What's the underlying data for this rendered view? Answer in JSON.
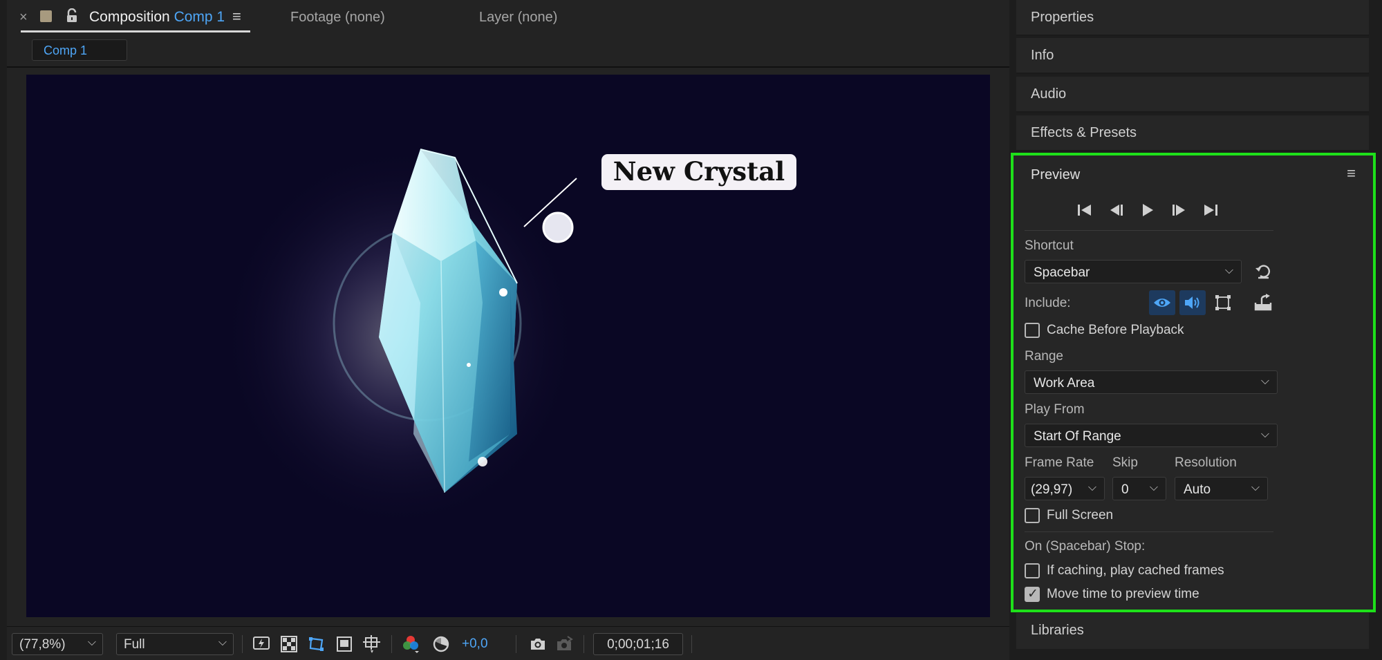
{
  "composition_panel": {
    "close_glyph": "×",
    "tab_title_prefix": "Composition",
    "tab_title_comp": "Comp 1",
    "menu_glyph": "≡",
    "footage_tab": "Footage (none)",
    "layer_tab": "Layer (none)",
    "comp_subtab": "Comp 1",
    "label_color": "#a79a7f",
    "accent_color": "#4ea6f7"
  },
  "viewer": {
    "background_color": "#0a0724",
    "callout_text": "New Crystal"
  },
  "viewer_toolbar": {
    "zoom": "(77,8%)",
    "resolution": "Full",
    "exposure": "+0,0",
    "timecode": "0;00;01;16",
    "icons": [
      "fast-preview-icon",
      "transparency-grid-icon",
      "mask-path-icon",
      "region-of-interest-icon",
      "guides-icon",
      "color-channels-icon",
      "reset-exposure-icon",
      "snapshot-icon",
      "show-snapshot-icon"
    ]
  },
  "right_panels": {
    "properties": "Properties",
    "info": "Info",
    "audio": "Audio",
    "effects_presets": "Effects & Presets",
    "libraries": "Libraries"
  },
  "preview": {
    "title": "Preview",
    "menu_glyph": "≡",
    "highlight_color": "#1ee01a",
    "controls": [
      "first-frame-icon",
      "previous-frame-icon",
      "play-icon",
      "next-frame-icon",
      "last-frame-icon"
    ],
    "shortcut_label": "Shortcut",
    "shortcut_value": "Spacebar",
    "include_label": "Include:",
    "cache_before_playback": {
      "label": "Cache Before Playback",
      "checked": false
    },
    "range_label": "Range",
    "range_value": "Work Area",
    "play_from_label": "Play From",
    "play_from_value": "Start Of Range",
    "frame_rate_label": "Frame Rate",
    "frame_rate_value": "(29,97)",
    "skip_label": "Skip",
    "skip_value": "0",
    "resolution_label": "Resolution",
    "resolution_value": "Auto",
    "full_screen": {
      "label": "Full Screen",
      "checked": false
    },
    "on_stop_label": "On (Spacebar) Stop:",
    "if_caching": {
      "label": "If caching, play cached frames",
      "checked": false
    },
    "move_time": {
      "label": "Move time to preview time",
      "checked": true
    }
  }
}
